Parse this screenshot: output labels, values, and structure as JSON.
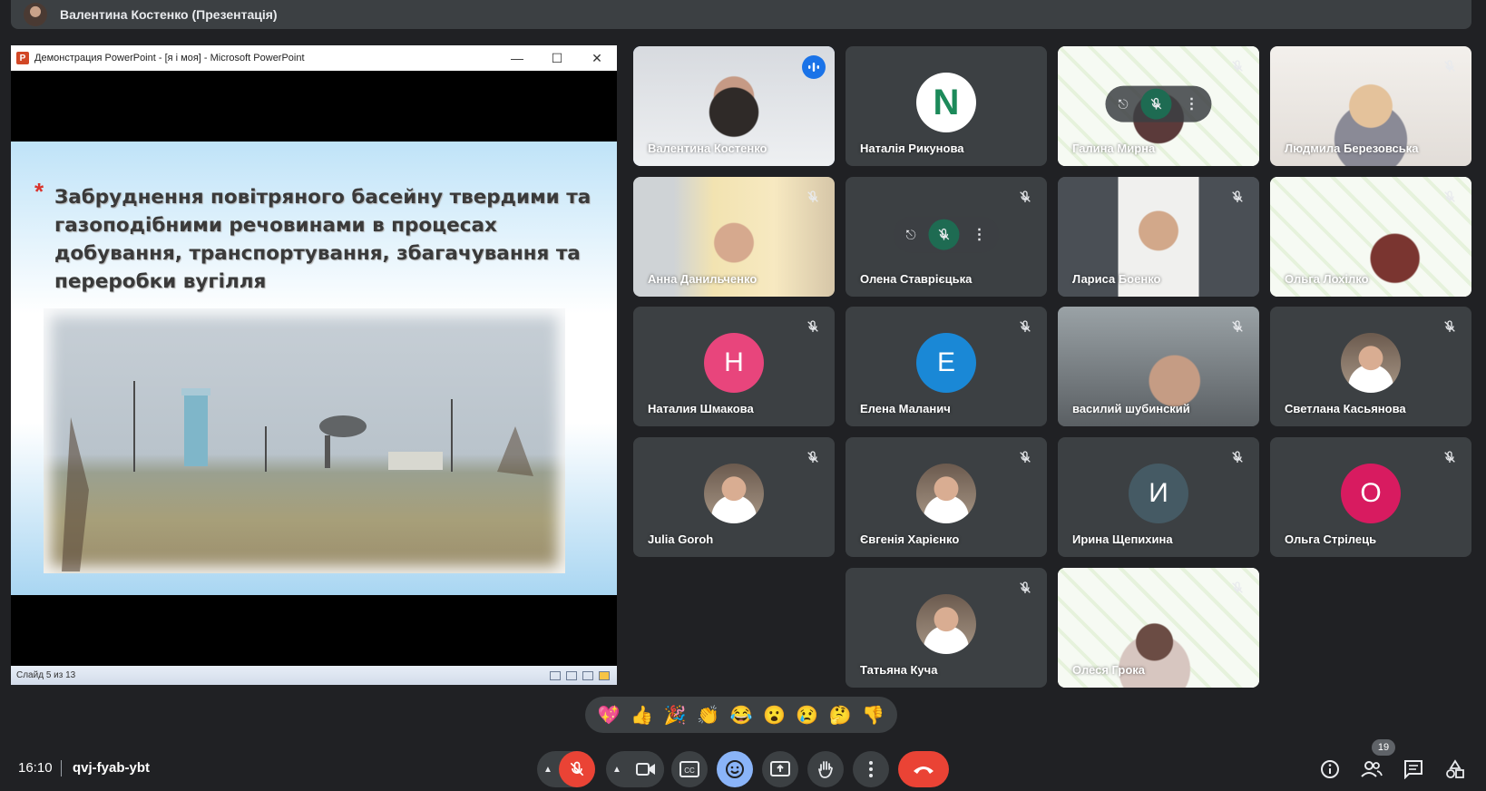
{
  "presenter": {
    "name": "Валентина Костенко (Презентація)"
  },
  "share": {
    "window_title": "Демонстрация PowerPoint - [я і моя] - Microsoft PowerPoint",
    "app_icon_letter": "P",
    "slide_text": "Забруднення повітряного басейну твердими та газоподібними речовинами в процесах добування, транспортування, збагачування та переробки вугілля",
    "bullet": "*",
    "status": "Слайд 5 из 13"
  },
  "participants": [
    {
      "name": "Валентина Костенко",
      "type": "video",
      "speaking": true
    },
    {
      "name": "Наталія Рикунова",
      "type": "logo",
      "letter": "N",
      "color": "#ffffff"
    },
    {
      "name": "Галина Мирна",
      "type": "video",
      "muted": true,
      "hover": true
    },
    {
      "name": "Людмила Березовська",
      "type": "video",
      "muted": true
    },
    {
      "name": "Анна Данильченко",
      "type": "video",
      "muted": true
    },
    {
      "name": "Олена Ставрієцька",
      "type": "hover",
      "muted": true
    },
    {
      "name": "Лариса Боенко",
      "type": "video",
      "muted": true
    },
    {
      "name": "Ольга Лохілко",
      "type": "video",
      "muted": true
    },
    {
      "name": "Наталия Шмакова",
      "type": "letter",
      "letter": "Н",
      "color": "#e8457c",
      "muted": true
    },
    {
      "name": "Елена Маланич",
      "type": "letter",
      "letter": "Е",
      "color": "#1a88d6",
      "muted": true
    },
    {
      "name": "василий шубинский",
      "type": "video",
      "muted": true
    },
    {
      "name": "Светлана Касьянова",
      "type": "photo",
      "muted": true
    },
    {
      "name": "Julia Goroh",
      "type": "photo",
      "muted": true
    },
    {
      "name": "Євгенія Харієнко",
      "type": "photo",
      "muted": true
    },
    {
      "name": "Ирина Щепихина",
      "type": "letter",
      "letter": "И",
      "color": "#455a64",
      "muted": true
    },
    {
      "name": "Ольга Стрілець",
      "type": "letter",
      "letter": "О",
      "color": "#d81b60",
      "muted": true
    },
    {
      "name": "Татьяна Куча",
      "type": "photo",
      "muted": true
    },
    {
      "name": "Олеся Грока",
      "type": "video",
      "muted": true
    }
  ],
  "reactions": [
    "💖",
    "👍",
    "🎉",
    "👏",
    "😂",
    "😮",
    "😢",
    "🤔",
    "👎"
  ],
  "bottom": {
    "time": "16:10",
    "meeting_code": "qvj-fyab-ybt",
    "participants_count": "19"
  },
  "colors": {
    "background": "#202124",
    "tile": "#3c4043",
    "accent": "#8ab4f8",
    "end_call": "#ea4335",
    "active_reaction": "#8ab4f8"
  }
}
